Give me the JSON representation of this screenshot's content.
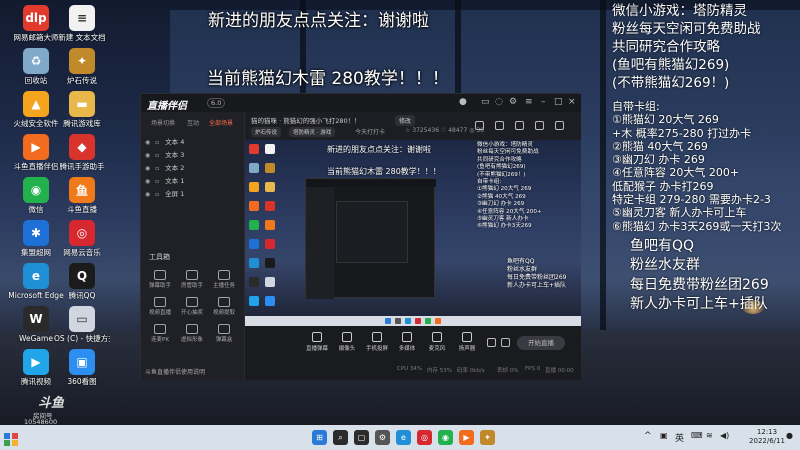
{
  "overlay": {
    "top_text": "新进的朋友点点关注：谢谢啦",
    "sub_text": "当前熊猫幻木雷 280教学！！！",
    "right_top": [
      "微信小游戏：塔防精灵",
      "粉丝每天空闲可免费助战",
      "共同研究合作攻略",
      "(鱼吧有熊猫幻269)",
      "(不带熊猫幻269！)"
    ],
    "right_cards_title": "自带卡组:",
    "right_cards": [
      "①熊猫幻 20大气 269",
      "     +木    概率275-280  打过办卡",
      "②熊猫               40大气 269",
      "③幽刀幻             办卡  269",
      "④任意阵容         20大气 200+",
      "   低配猴子              办卡打269",
      "   特定卡组   279-280 需要办卡2-3",
      "⑤幽灵刀客   新人办卡可上车",
      "⑥熊猫幻    办卡3天269或一天打3次"
    ],
    "right_bottom": [
      "鱼吧有QQ",
      "粉丝水友群",
      "每日免费带粉丝团269",
      "新人办卡可上车+插队"
    ]
  },
  "desktop_icons": [
    {
      "label": "网易邮箱大师",
      "icon": "mail-icon",
      "color": "#e23b2e",
      "glyph": "dlp"
    },
    {
      "label": "新建 文本文档",
      "icon": "text-file-icon",
      "color": "#f2f2f2",
      "glyph": "≡"
    },
    {
      "label": "回收站",
      "icon": "recycle-bin-icon",
      "color": "#7fa8c9",
      "glyph": "♻"
    },
    {
      "label": "炉石传说",
      "icon": "hearthstone-icon",
      "color": "#c08a2a",
      "glyph": "✦"
    },
    {
      "label": "火绒安全软件",
      "icon": "huorong-icon",
      "color": "#f4a41d",
      "glyph": "▲"
    },
    {
      "label": "腾讯游戏库",
      "icon": "folder-icon",
      "color": "#e9b84a",
      "glyph": "▬"
    },
    {
      "label": "斗鱼直播伴侣",
      "icon": "douyu-assistant-icon",
      "color": "#f26b1f",
      "glyph": "▶"
    },
    {
      "label": "腾讯手游助手",
      "icon": "tencent-mobile-icon",
      "color": "#d9342b",
      "glyph": "◆"
    },
    {
      "label": "微信",
      "icon": "wechat-icon",
      "color": "#22b14c",
      "glyph": "◉"
    },
    {
      "label": "斗鱼直播",
      "icon": "douyu-icon",
      "color": "#f07a1a",
      "glyph": "鱼"
    },
    {
      "label": "集盟超网",
      "icon": "network-icon",
      "color": "#1e6fd6",
      "glyph": "✱"
    },
    {
      "label": "网易云音乐",
      "icon": "netease-music-icon",
      "color": "#d6282e",
      "glyph": "◎"
    },
    {
      "label": "Microsoft Edge",
      "icon": "edge-icon",
      "color": "#1f8fd6",
      "glyph": "e"
    },
    {
      "label": "腾讯QQ",
      "icon": "qq-icon",
      "color": "#1b1b1b",
      "glyph": "Q"
    },
    {
      "label": "WeGame",
      "icon": "wegame-icon",
      "color": "#2a2a2a",
      "glyph": "W"
    },
    {
      "label": "OS (C) - 快捷方式",
      "icon": "drive-shortcut-icon",
      "color": "#cfd6df",
      "glyph": "▭"
    },
    {
      "label": "腾讯视频",
      "icon": "tencent-video-icon",
      "color": "#21a5e8",
      "glyph": "▶"
    },
    {
      "label": "360看图",
      "icon": "image-viewer-icon",
      "color": "#2b8ef0",
      "glyph": "▣"
    }
  ],
  "app": {
    "logo": "直播伴侣",
    "version": "6.0",
    "tabs": [
      "场景切换",
      "互动",
      "全部场景"
    ],
    "scenes": [
      "文本 4",
      "文本 3",
      "文本 2",
      "文本 1",
      "全屏 1"
    ],
    "tools_title": "工具箱",
    "tools": [
      "弹幕助手",
      "房管助手",
      "主播任务",
      "视频直播",
      "开心抽奖",
      "视频提取",
      "连麦PK",
      "虚拟形象",
      "弹幕盒"
    ],
    "notice": "斗鱼直播伴侣使用说明",
    "room_title": "猫的猫咪 · 熊猫幻的强小飞打280！！",
    "room_edit": "修改",
    "room_tags": [
      "炉石传说",
      "塔防精灵 · 游戏",
      "今天打打卡"
    ],
    "room_stats": "☆ 3725436    ♡ 48477    ◎ 36",
    "bottom_buttons": [
      "直播弹幕",
      "摄像头",
      "手机投屏",
      "多媒体",
      "麦克风",
      "扬声器"
    ],
    "start_label": "开始直播",
    "status_items": [
      "CPU 34%",
      "内存 53%",
      "码率 0kb/s",
      "丢帧 0%",
      "FPS 0",
      "直播 00:00"
    ]
  },
  "preview": {
    "text1": "新进的朋友点点关注：谢谢啦",
    "text2": "当前熊猫幻木雷 280教学！！！",
    "right_lines": [
      "微信小游戏：塔防精灵",
      "粉丝每天空闲可免费助战",
      "共同研究合作攻略",
      "(鱼吧有熊猫幻269)",
      "(不带熊猫幻269！)",
      "自带卡组:",
      "①熊猫幻 20大气 269",
      "②熊猫    40大气 269",
      "③幽刀幻   办卡 269",
      "④任意阵容  20大气 200+",
      "⑤幽灵刀客  新人办卡",
      "⑥熊猫幻 办卡3天269"
    ],
    "bottom_lines": [
      "鱼吧有QQ",
      "粉丝水友群",
      "每日免费带粉丝团269",
      "新人办卡可上车+插队"
    ]
  },
  "watermark": {
    "logo": "斗鱼",
    "room_label": "房间号",
    "room_number": "10548600"
  },
  "taskbar": {
    "apps": [
      {
        "icon": "start-icon",
        "color": "#2a7bd8",
        "glyph": "⊞"
      },
      {
        "icon": "search-icon",
        "color": "#2b2b2b",
        "glyph": "⌕"
      },
      {
        "icon": "task-view-icon",
        "color": "#2b2b2b",
        "glyph": "▢"
      },
      {
        "icon": "settings-icon",
        "color": "#555",
        "glyph": "⚙"
      },
      {
        "icon": "edge-icon",
        "color": "#1f8fd6",
        "glyph": "e"
      },
      {
        "icon": "netease-music-icon",
        "color": "#d6282e",
        "glyph": "◎"
      },
      {
        "icon": "wechat-icon",
        "color": "#22b14c",
        "glyph": "◉"
      },
      {
        "icon": "douyu-assistant-icon",
        "color": "#f26b1f",
        "glyph": "▶"
      },
      {
        "icon": "hearthstone-icon",
        "color": "#c08a2a",
        "glyph": "✦"
      }
    ],
    "ime": "英",
    "time": "12:13",
    "date": "2022/6/11"
  }
}
